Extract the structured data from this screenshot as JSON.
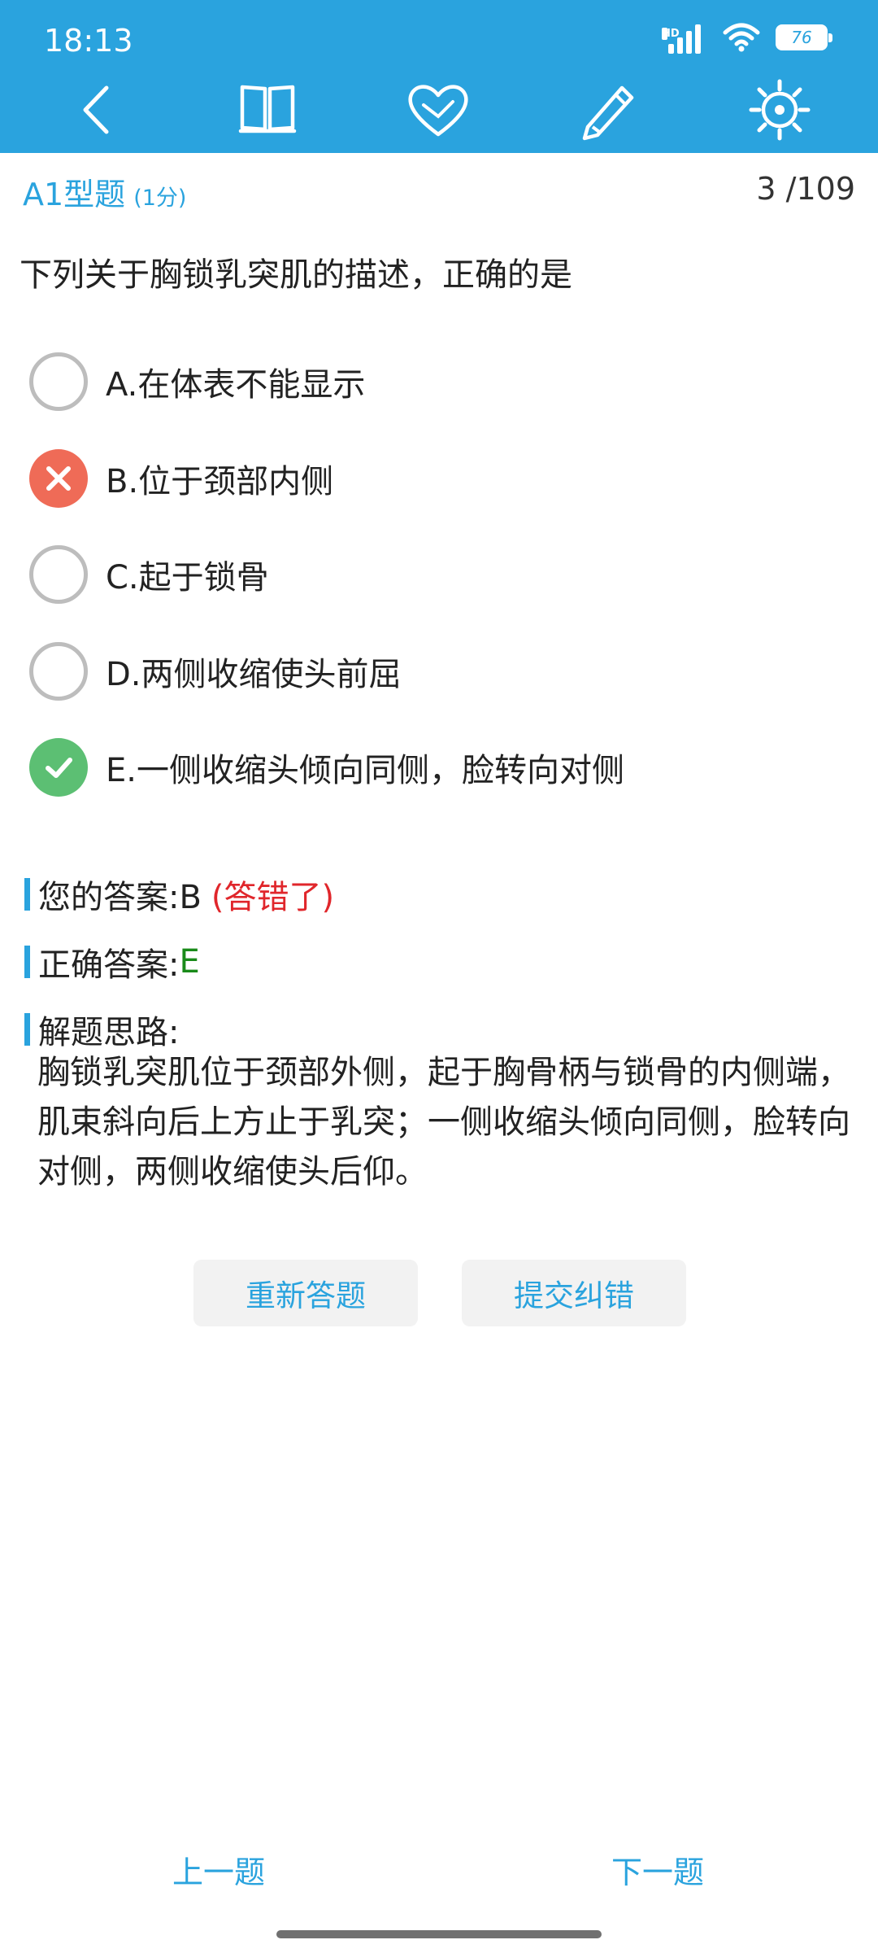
{
  "status": {
    "time": "18:13",
    "network": "HD",
    "battery": "76"
  },
  "toolbar": {
    "icons": [
      "back-icon",
      "book-icon",
      "heart-icon",
      "pencil-icon",
      "settings-icon"
    ]
  },
  "header": {
    "type": "A1型题",
    "score": "(1分)",
    "progress": "3 /109"
  },
  "question": {
    "text": "下列关于胸锁乳突肌的描述，正确的是",
    "options": [
      {
        "label": "A.在体表不能显示",
        "state": "none"
      },
      {
        "label": "B.位于颈部内侧",
        "state": "wrong"
      },
      {
        "label": "C.起于锁骨",
        "state": "none"
      },
      {
        "label": "D.两侧收缩使头前屈",
        "state": "none"
      },
      {
        "label": "E.一侧收缩头倾向同侧，脸转向对侧",
        "state": "correct"
      }
    ]
  },
  "result": {
    "your_answer_label": "您的答案:B",
    "your_answer_status": "(答错了)",
    "correct_label": "正确答案:",
    "correct_value": "E",
    "explain_title": "解题思路:",
    "explain_text": "胸锁乳突肌位于颈部外侧，起于胸骨柄与锁骨的内侧端，肌束斜向后上方止于乳突；一侧收缩头倾向同侧，脸转向对侧，两侧收缩使头后仰。"
  },
  "buttons": {
    "retry": "重新答题",
    "report": "提交纠错"
  },
  "nav": {
    "prev": "上一题",
    "next": "下一题"
  },
  "colors": {
    "accent": "#2aa3de",
    "wrong": "#e0262b",
    "correct": "#1a8a1a"
  }
}
